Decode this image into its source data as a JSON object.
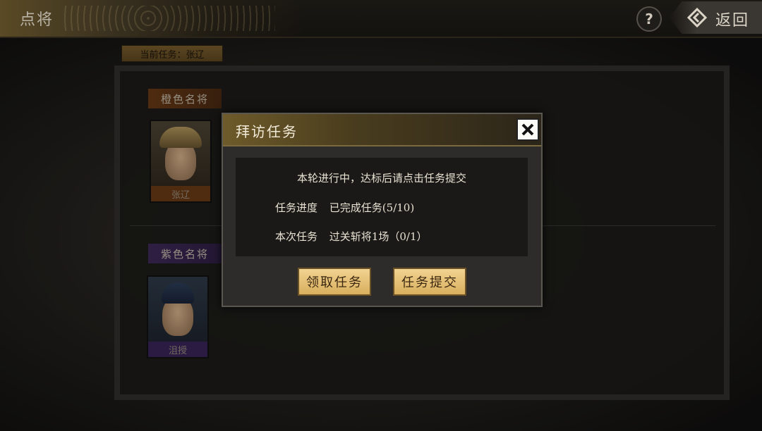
{
  "header": {
    "title": "点将",
    "help_icon": "question-icon",
    "back_label": "返回",
    "back_icon": "back-diamond-icon"
  },
  "current_task": {
    "label": "当前任务：张辽"
  },
  "sections": {
    "orange": {
      "label": "橙色名将",
      "general_name": "张辽"
    },
    "purple": {
      "label": "紫色名将",
      "general_name": "沮授"
    }
  },
  "dialog": {
    "title": "拜访任务",
    "notice": "本轮进行中，达标后请点击任务提交",
    "progress_label": "任务进度",
    "progress_value": "已完成任务(5/10)",
    "current_label": "本次任务",
    "current_value": "过关斩将1场（0/1）",
    "accept_button": "领取任务",
    "submit_button": "任务提交",
    "close_icon": "close-icon"
  },
  "colors": {
    "gold_button": "#e3bd72",
    "orange_rank": "#6a3a16",
    "purple_rank": "#3f2a5a"
  }
}
